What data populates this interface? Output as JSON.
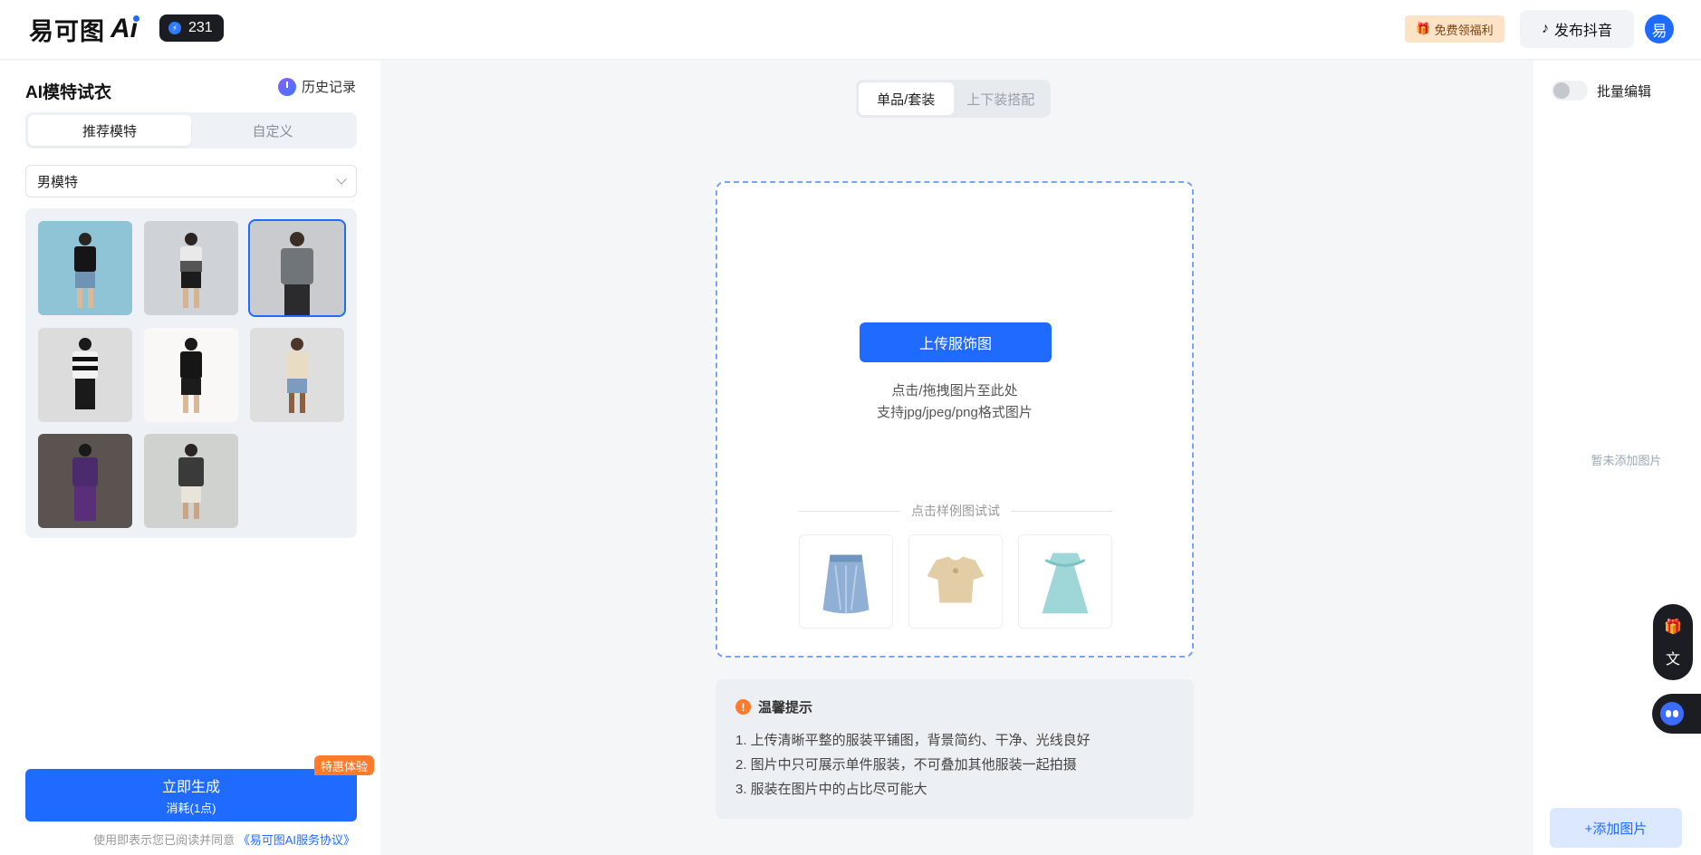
{
  "header": {
    "logo_text": "易可图",
    "logo_ai": "Ai",
    "credits": "231",
    "welfare_label": "免费领福利",
    "douyin_label": "发布抖音",
    "avatar_letter": "易"
  },
  "left_panel": {
    "title": "AI模特试衣",
    "history_label": "历史记录",
    "tabs": [
      {
        "label": "推荐模特",
        "active": true
      },
      {
        "label": "自定义",
        "active": false
      }
    ],
    "model_select": "男模特",
    "models": [
      {
        "name": "model-1",
        "selected": false
      },
      {
        "name": "model-2",
        "selected": false
      },
      {
        "name": "model-3",
        "selected": true
      },
      {
        "name": "model-4",
        "selected": false
      },
      {
        "name": "model-5",
        "selected": false
      },
      {
        "name": "model-6",
        "selected": false
      },
      {
        "name": "model-7",
        "selected": false
      },
      {
        "name": "model-8",
        "selected": false
      }
    ],
    "generate_label": "立即生成",
    "generate_cost": "消耗(1点)",
    "promo_badge": "特惠体验",
    "agreement_prefix": "使用即表示您已阅读并同意",
    "agreement_link": "《易可图AI服务协议》"
  },
  "center": {
    "tabs": [
      {
        "label": "单品/套装",
        "active": true
      },
      {
        "label": "上下装搭配",
        "active": false
      }
    ],
    "upload_label": "上传服饰图",
    "upload_hint_1": "点击/拖拽图片至此处",
    "upload_hint_2": "支持jpg/jpeg/png格式图片",
    "sample_title": "点击样例图试试",
    "samples": [
      "skirt",
      "blouse",
      "dress"
    ],
    "tips_title": "温馨提示",
    "tips": [
      "1. 上传清晰平整的服装平铺图，背景简约、干净、光线良好",
      "2. 图片中只可展示单件服装，不可叠加其他服装一起拍摄",
      "3. 服装在图片中的占比尽可能大"
    ]
  },
  "right_panel": {
    "batch_label": "批量编辑",
    "empty_text": "暂未添加图片",
    "add_label": "+添加图片"
  },
  "colors": {
    "primary": "#1f6bff",
    "promo": "#ff7a2a",
    "dark": "#1b1d22"
  }
}
